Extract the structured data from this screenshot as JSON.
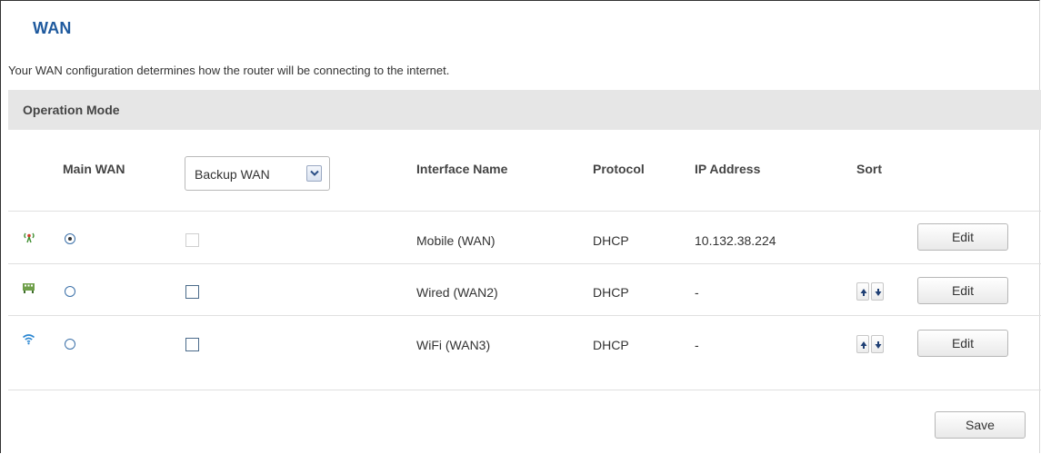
{
  "page": {
    "title": "WAN",
    "description": "Your WAN configuration determines how the router will be connecting to the internet."
  },
  "section": {
    "title": "Operation Mode"
  },
  "table": {
    "headers": {
      "main_wan": "Main WAN",
      "backup_select": "Backup WAN",
      "interface_name": "Interface Name",
      "protocol": "Protocol",
      "ip_address": "IP Address",
      "sort": "Sort"
    },
    "rows": [
      {
        "icon": "mobile-signal-icon",
        "interface": "Mobile (WAN)",
        "protocol": "DHCP",
        "ip": "10.132.38.224",
        "main_selected": true,
        "backup_checked": false,
        "backup_disabled": true,
        "sortable": false,
        "edit_label": "Edit"
      },
      {
        "icon": "ethernet-port-icon",
        "interface": "Wired (WAN2)",
        "protocol": "DHCP",
        "ip": "-",
        "main_selected": false,
        "backup_checked": false,
        "backup_disabled": false,
        "sortable": true,
        "edit_label": "Edit"
      },
      {
        "icon": "wifi-icon",
        "interface": "WiFi (WAN3)",
        "protocol": "DHCP",
        "ip": "-",
        "main_selected": false,
        "backup_checked": false,
        "backup_disabled": false,
        "sortable": true,
        "edit_label": "Edit"
      }
    ]
  },
  "actions": {
    "save_label": "Save"
  },
  "colors": {
    "title": "#1f5a9e",
    "header_bg": "#e6e6e6",
    "icon_green": "#3e8e2f",
    "icon_blue": "#2a86d1"
  }
}
